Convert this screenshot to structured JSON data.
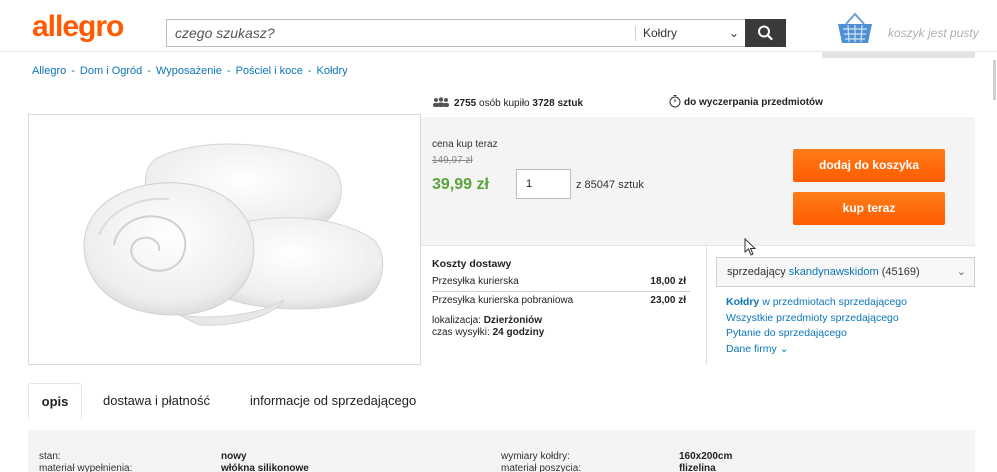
{
  "header": {
    "logo": "allegro",
    "search_placeholder": "czego szukasz?",
    "category": "Kołdry",
    "cart_text": "koszyk jest pusty"
  },
  "breadcrumb": [
    "Allegro",
    "Dom i Ogród",
    "Wyposażenie",
    "Pościel i koce",
    "Kołdry"
  ],
  "stats": {
    "people_count": "2755",
    "people_text": "osób kupiło",
    "items_count": "3728",
    "items_unit": "sztuk",
    "timer_text": "do wyczerpania przedmiotów"
  },
  "price": {
    "label": "cena kup teraz",
    "old": "149,97 zł",
    "now": "39,99 zł",
    "quantity": "1",
    "stock": "z 85047 sztuk",
    "add_to_cart": "dodaj do koszyka",
    "buy_now": "kup teraz"
  },
  "delivery": {
    "title": "Koszty dostawy",
    "rows": [
      {
        "name": "Przesyłka kurierska",
        "price": "18,00 zł"
      },
      {
        "name": "Przesyłka kurierska pobraniowa",
        "price": "23,00 zł"
      }
    ],
    "location_label": "lokalizacja:",
    "location": "Dzierżoniów",
    "ship_label": "czas wysyłki:",
    "ship_time": "24 godziny"
  },
  "seller": {
    "label": "sprzedający",
    "name": "skandynawskidom",
    "rating": "(45169)",
    "links": {
      "items_bold": "Kołdry",
      "items_rest": "w przedmiotach sprzedającego",
      "all_items": "Wszystkie przedmioty sprzedającego",
      "ask": "Pytanie do sprzedającego",
      "company": "Dane firmy"
    }
  },
  "tabs": [
    "opis",
    "dostawa i płatność",
    "informacje od sprzedającego"
  ],
  "details": [
    {
      "label": "stan:",
      "value": "nowy"
    },
    {
      "label": "materiał wypełnienia:",
      "value": "włókna silikonowe"
    },
    {
      "label": "wymiary kołdry:",
      "value": "160x200cm"
    },
    {
      "label": "materiał poszycia:",
      "value": "flizelina"
    }
  ],
  "colors": {
    "brand": "#ff5a00",
    "price_green": "#5ba33b",
    "link_blue": "#0c75b8",
    "button_orange": "#ff6b00"
  }
}
